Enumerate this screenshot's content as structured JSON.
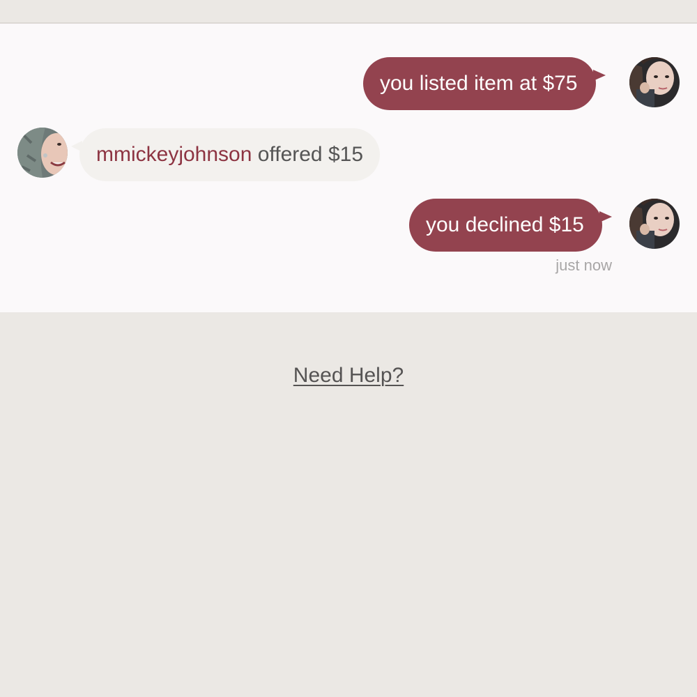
{
  "messages": [
    {
      "direction": "outgoing",
      "text": "you listed item at $75",
      "avatar": "user-avatar"
    },
    {
      "direction": "incoming",
      "username": "mmickeyjohnson",
      "text": " offered $15",
      "avatar": "buyer-avatar"
    },
    {
      "direction": "outgoing",
      "text": "you declined $15",
      "avatar": "user-avatar"
    }
  ],
  "timestamp": "just now",
  "help_link": "Need Help?",
  "colors": {
    "outgoing_bubble": "#93434f",
    "incoming_bubble": "#f3f1ee",
    "username": "#8d3442",
    "chat_background": "#fbf9fa",
    "page_background": "#ebe8e4"
  }
}
